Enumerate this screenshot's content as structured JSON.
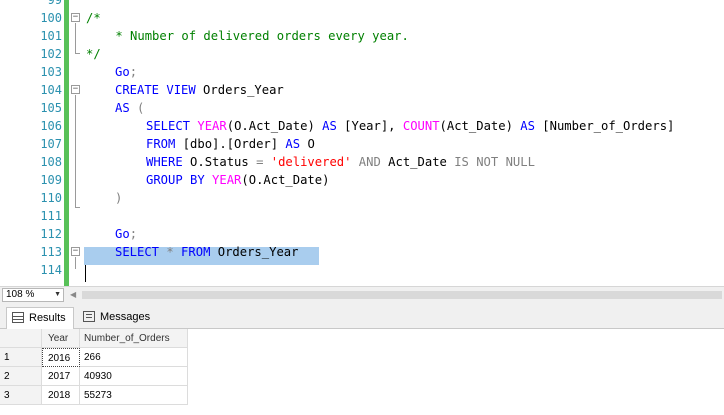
{
  "editor": {
    "line_numbers": [
      "100",
      "101",
      "102",
      "103",
      "104",
      "105",
      "106",
      "107",
      "108",
      "109",
      "110",
      "111",
      "112",
      "113",
      "114"
    ],
    "lines": {
      "l100": "/*",
      "l101": "    * Number of delivered orders every year.",
      "l102": "*/",
      "l103_kw": "Go",
      "l103_p": ";",
      "l104_kw": "CREATE VIEW",
      "l104_name": " Orders_Year",
      "l105_kw": "AS",
      "l105_p": " (",
      "l106_select": "SELECT",
      "l106_year_fn": "YEAR",
      "l106_a": "(O.Act_Date) ",
      "l106_as1": "AS",
      "l106_b": " [Year], ",
      "l106_count_fn": "COUNT",
      "l106_c": "(Act_Date) ",
      "l106_as2": "AS",
      "l106_d": " [Number_of_Orders]",
      "l107_from": "FROM",
      "l107_a": " [dbo].[Order] ",
      "l107_as": "AS",
      "l107_b": " O",
      "l108_where": "WHERE",
      "l108_a": " O.Status ",
      "l108_eq": "=",
      "l108_str": " 'delivered'",
      "l108_and": " AND",
      "l108_b": " Act_Date ",
      "l108_isnot": "IS NOT NULL",
      "l109_group": "GROUP BY",
      "l109_fn": " YEAR",
      "l109_a": "(O.Act_Date)",
      "l110": ")",
      "l112_kw": "Go",
      "l112_p": ";",
      "l113_select": "SELECT",
      "l113_star": " *",
      "l113_from": " FROM",
      "l113_name": " Orders_Year"
    }
  },
  "statusbar": {
    "zoom": "108 %"
  },
  "results": {
    "tabs": {
      "results": "Results",
      "messages": "Messages"
    },
    "columns": [
      "Year",
      "Number_of_Orders"
    ],
    "rows": [
      {
        "num": "1",
        "year": "2016",
        "orders": "266"
      },
      {
        "num": "2",
        "year": "2017",
        "orders": "40930"
      },
      {
        "num": "3",
        "year": "2018",
        "orders": "55273"
      }
    ]
  }
}
